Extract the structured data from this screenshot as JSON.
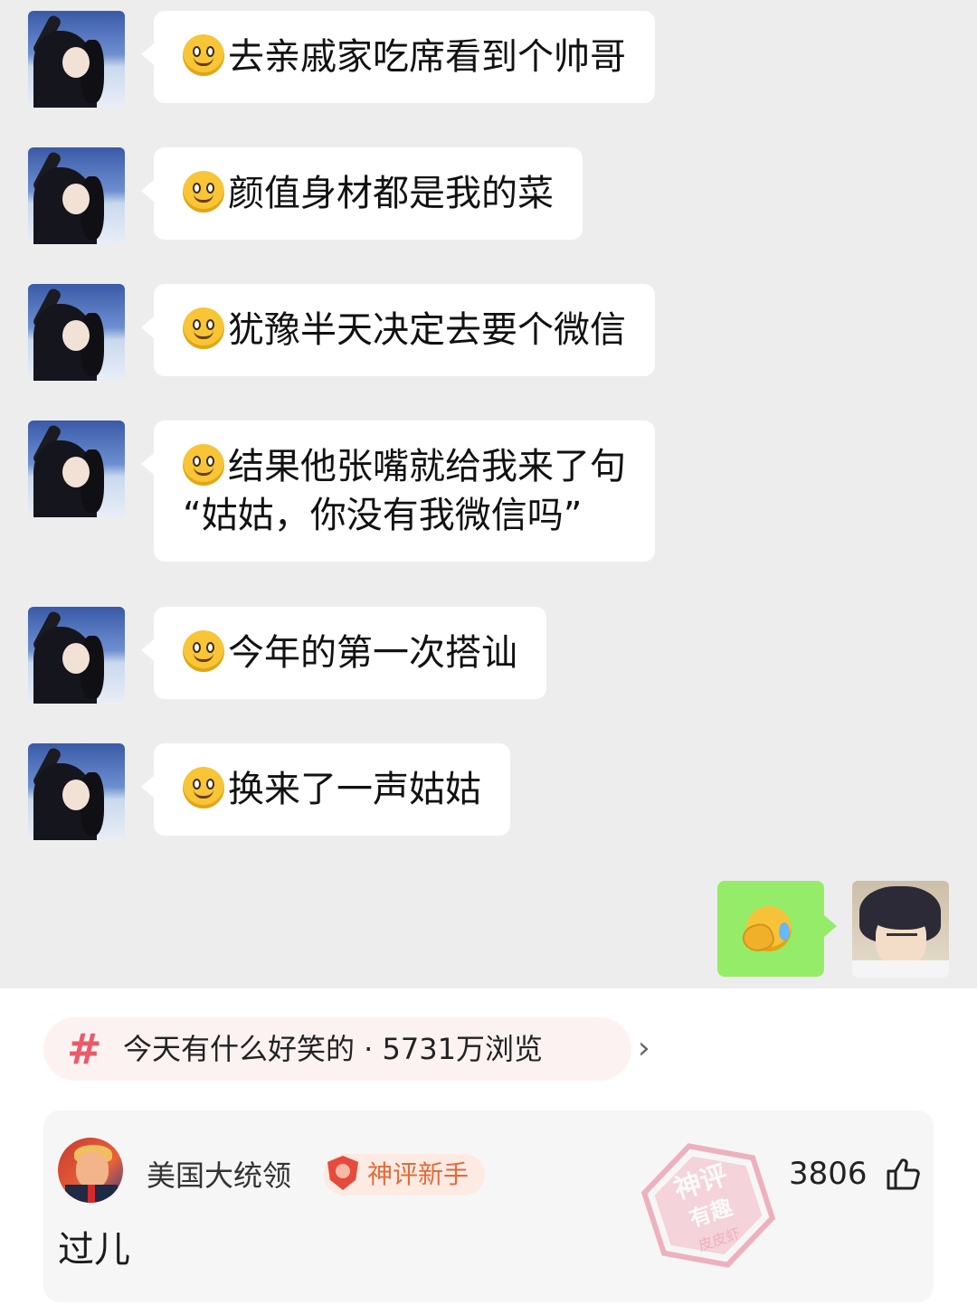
{
  "chat": {
    "messages": [
      {
        "emoji": "smile-emoji",
        "text": "去亲戚家吃席看到个帅哥"
      },
      {
        "emoji": "smile-emoji",
        "text": "颜值身材都是我的菜"
      },
      {
        "emoji": "smile-emoji",
        "text": "犹豫半天决定去要个微信"
      },
      {
        "emoji": "smile-emoji",
        "text": "结果他张嘴就给我来了句\n“姑姑，你没有我微信吗”"
      },
      {
        "emoji": "smile-emoji",
        "text": "今年的第一次搭讪"
      },
      {
        "emoji": "smile-emoji",
        "text": "换来了一声姑姑"
      }
    ],
    "reply": {
      "emoji": "face-palm-crying-emoji"
    }
  },
  "topic": {
    "icon": "hashtag-icon",
    "text": "今天有什么好笑的 · 5731万浏览",
    "chevron": "›"
  },
  "comment": {
    "username": "美国大统领",
    "badge": "神评新手",
    "text": "过儿",
    "likes": "3806",
    "stamp": {
      "line1": "神评",
      "line2": "有趣",
      "line3": "皮皮虾"
    }
  },
  "colors": {
    "chat_bg": "#ededed",
    "sent_bubble": "#95ec69",
    "accent": "#ea5a6a",
    "badge_text": "#e36a3a"
  }
}
